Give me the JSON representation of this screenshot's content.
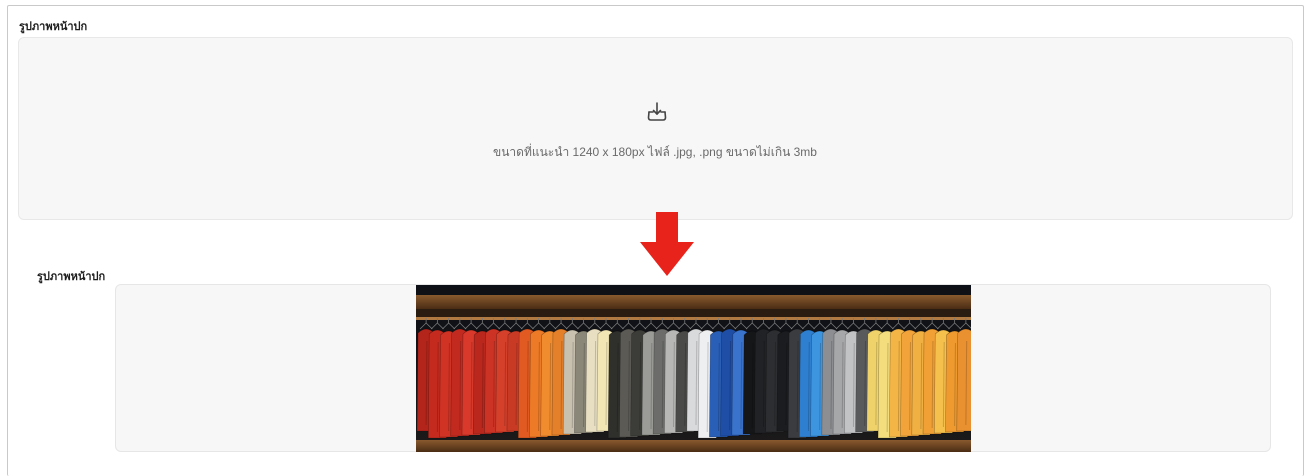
{
  "upload_section": {
    "label": "รูปภาพหน้าปก",
    "icon": "download-tray-icon",
    "hint": "ขนาดที่แนะนำ 1240 x 180px ไฟล์ .jpg, .png ขนาดไม่เกิน 3mb"
  },
  "indicator": {
    "icon": "arrow-down-icon",
    "color": "#e8231b"
  },
  "preview_section": {
    "label": "รูปภาพหน้าปก",
    "image": "cover-image-tshirt-rack"
  },
  "shirt_colors": [
    "#b3241a",
    "#c42a1e",
    "#d03224",
    "#c22a20",
    "#d8392a",
    "#b9271d",
    "#cc3325",
    "#d5402b",
    "#c93a25",
    "#e05a22",
    "#ec7a26",
    "#f08c2e",
    "#e47f2a",
    "#c8c1b0",
    "#8a8778",
    "#e8dfc2",
    "#f2e6b4",
    "#2f2f2c",
    "#5b5a55",
    "#3c3d38",
    "#9b9c98",
    "#6c6d6a",
    "#b7b8b5",
    "#4a4b48",
    "#d9dadc",
    "#eeeff1",
    "#2a5fb7",
    "#1f4ea6",
    "#3a73cc",
    "#141618",
    "#202225",
    "#2c2e31",
    "#1a1c1f",
    "#3a3c40",
    "#2e7fd0",
    "#3d95e0",
    "#8c8e91",
    "#a6a7a9",
    "#c2c3c5",
    "#595a5c",
    "#efd36a",
    "#f3dd7c",
    "#f4b547",
    "#f2a43a",
    "#f1b142",
    "#f0a035",
    "#f5c04c",
    "#ee9a2f",
    "#e99030"
  ]
}
